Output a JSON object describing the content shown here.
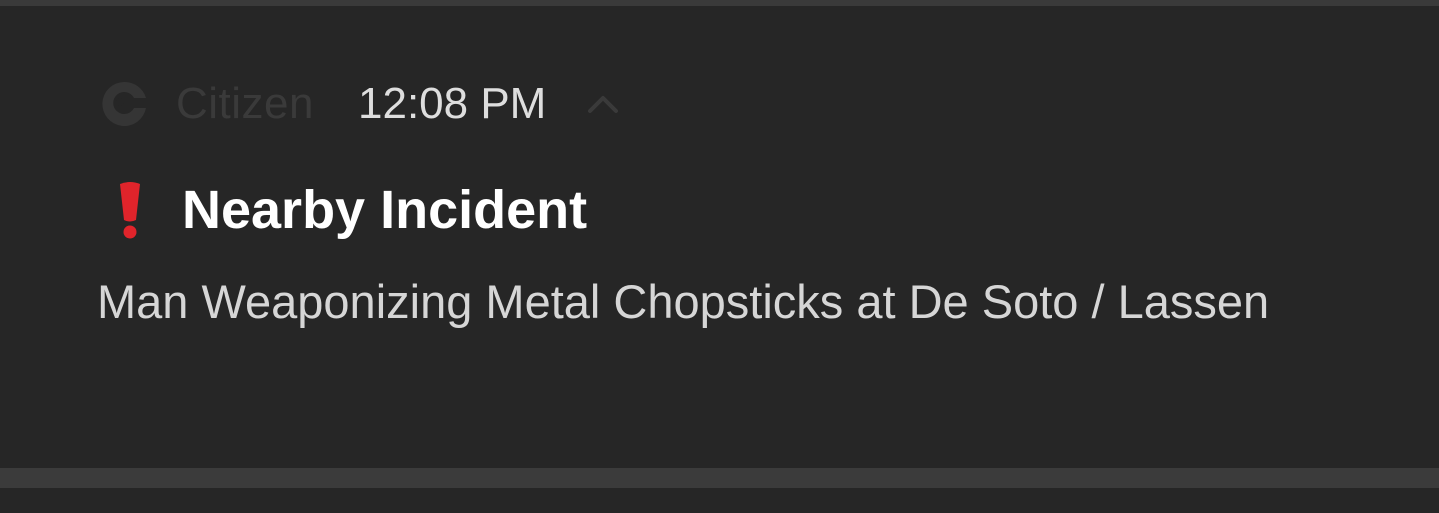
{
  "notification": {
    "app_name": "Citizen",
    "time": "12:08 PM",
    "title": "Nearby Incident",
    "body": "Man Weaponizing Metal Chopsticks at De Soto / Lassen",
    "icons": {
      "app": "citizen-logo-icon",
      "expand": "chevron-up-icon",
      "alert": "red-exclamation-icon"
    },
    "colors": {
      "background": "#262626",
      "divider": "#3b3b3b",
      "title": "#ffffff",
      "body": "#d6d6d6",
      "timestamp": "#dedede",
      "app_name": "#3a3a3a",
      "alert": "#e0242b"
    }
  }
}
